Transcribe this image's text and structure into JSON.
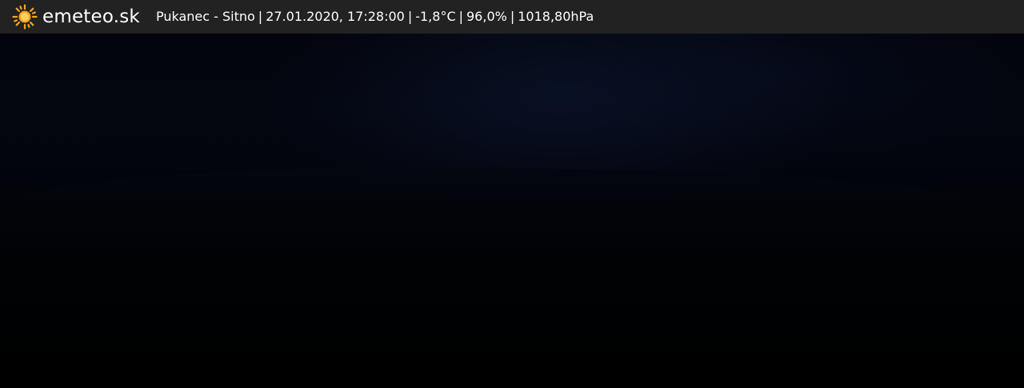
{
  "brand": {
    "name": "emeteo.sk",
    "logo_icon": "sun-icon",
    "logo_color": "#f5a623"
  },
  "station": {
    "location": "Pukanec - Sitno",
    "datetime": "27.01.2020, 17:28:00",
    "temperature": "-1,8°C",
    "humidity": "96,0%",
    "pressure": "1018,80hPa",
    "separator": "|"
  },
  "colors": {
    "header_background": "#222222",
    "header_text": "#ffffff"
  }
}
